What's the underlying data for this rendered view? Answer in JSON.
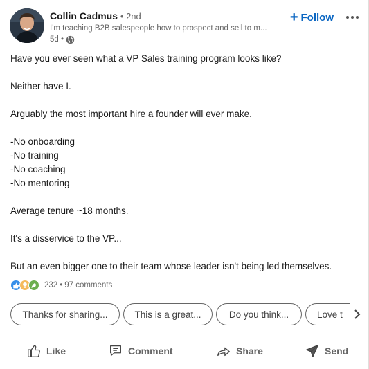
{
  "author": {
    "name": "Collin Cadmus",
    "degree": "• 2nd",
    "headline": "I'm teaching B2B salespeople how to prospect and sell to m...",
    "time": "5d •"
  },
  "header": {
    "follow_label": "Follow",
    "more_icon": "more-horizontal-icon"
  },
  "post": {
    "lines": [
      "Have you ever seen what a VP Sales training program looks like?",
      "Neither have I.",
      "Arguably the most important hire a founder will ever make.",
      "-No onboarding",
      "-No training",
      "-No coaching",
      "-No mentoring",
      "Average tenure ~18 months.",
      "It's a disservice to the VP...",
      "But an even bigger one to their team whose leader isn't being led themselves."
    ]
  },
  "social": {
    "reactions": [
      "like-reaction-icon",
      "insightful-reaction-icon",
      "support-reaction-icon"
    ],
    "reaction_count": "232",
    "separator": "•",
    "comments": "97 comments"
  },
  "suggestions": [
    "Thanks for sharing...",
    "This is a great...",
    "Do you think...",
    "Love t"
  ],
  "actions": {
    "like": "Like",
    "comment": "Comment",
    "share": "Share",
    "send": "Send"
  },
  "colors": {
    "accent": "#0a66c2",
    "muted_text": "#666666",
    "like_blue": "#378fe9",
    "insight_yellow": "#f5bb5c",
    "support_green": "#6dae4f"
  }
}
